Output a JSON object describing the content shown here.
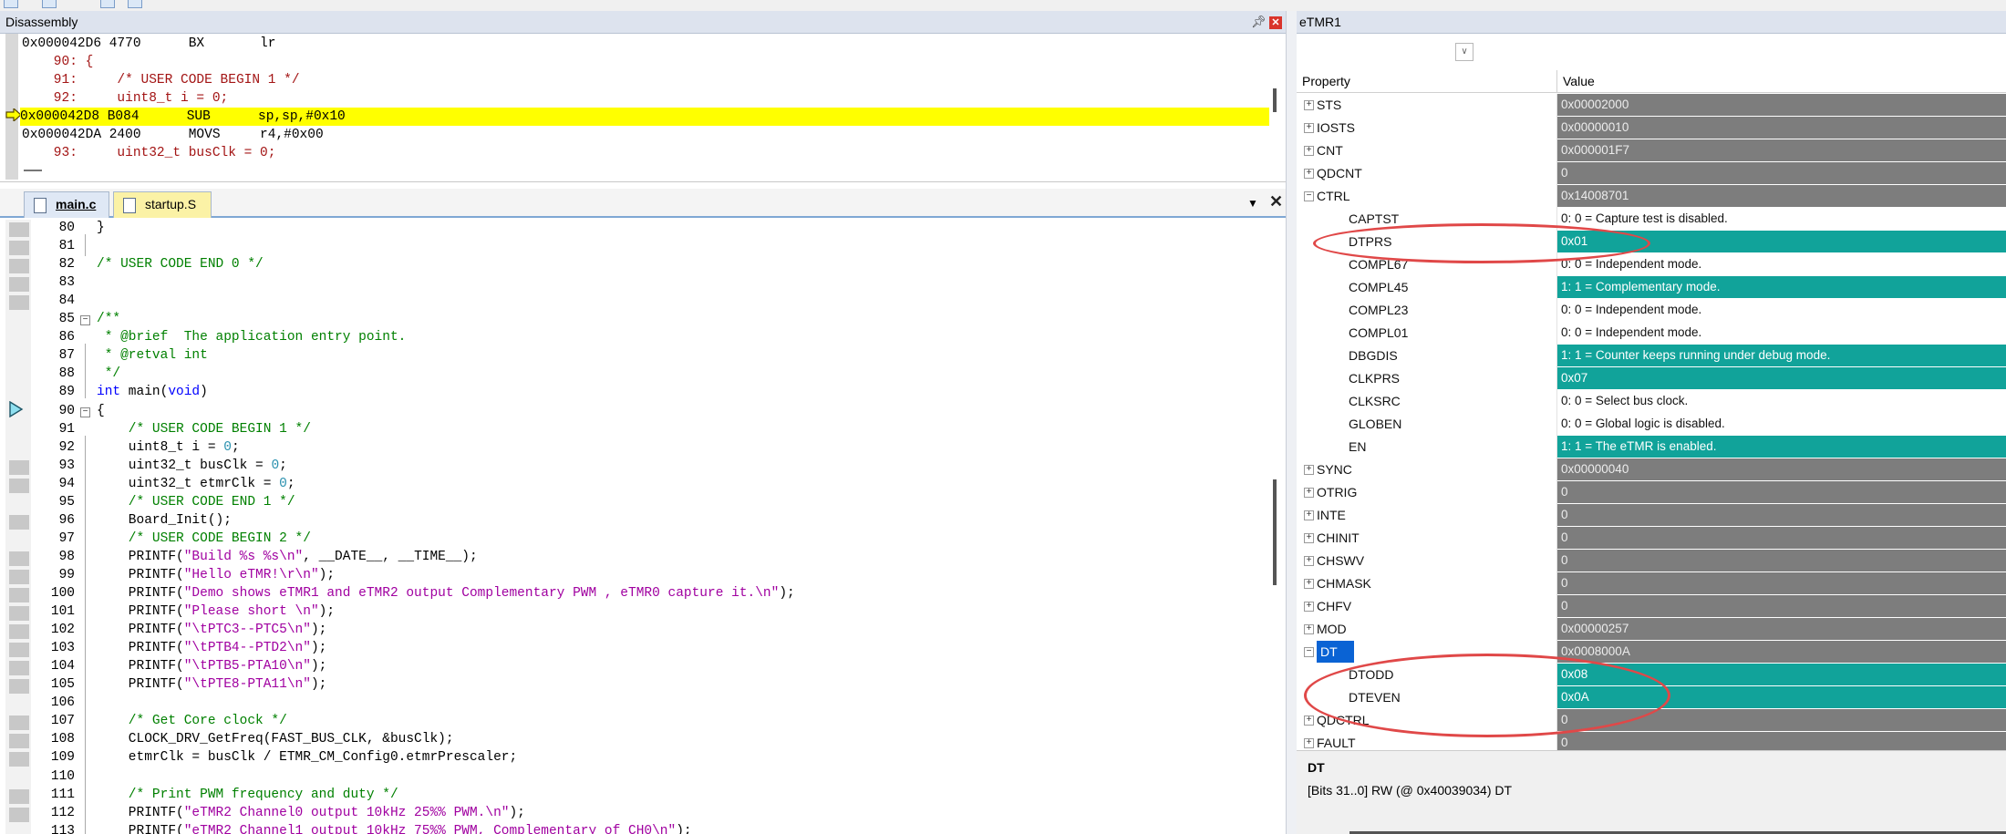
{
  "disassembly": {
    "title": "Disassembly",
    "pin_icon": "pin-icon",
    "close_icon": "close-icon",
    "lines": [
      {
        "text": "0x000042D6 4770      BX       lr",
        "kind": "asm"
      },
      {
        "text": "    90: {",
        "kind": "src"
      },
      {
        "text": "    91:     /* USER CODE BEGIN 1 */",
        "kind": "src"
      },
      {
        "text": "    92:     uint8_t i = 0;",
        "kind": "src"
      },
      {
        "text": "0x000042D8 B084      SUB      sp,sp,#0x10",
        "kind": "current"
      },
      {
        "text": "0x000042DA 2400      MOVS     r4,#0x00",
        "kind": "asm"
      },
      {
        "text": "    93:     uint32_t busClk = 0;",
        "kind": "src"
      }
    ]
  },
  "editor": {
    "tabs": [
      {
        "label": "main.c",
        "active": true
      },
      {
        "label": "startup.S",
        "active": false
      }
    ],
    "lines": [
      {
        "n": "80",
        "code": "}"
      },
      {
        "n": "81",
        "code": ""
      },
      {
        "n": "82",
        "code": "/* USER CODE END 0 */"
      },
      {
        "n": "83",
        "code": ""
      },
      {
        "n": "84",
        "code": ""
      },
      {
        "n": "85",
        "code": "/**"
      },
      {
        "n": "86",
        "code": " * @brief  The application entry point."
      },
      {
        "n": "87",
        "code": " * @retval int"
      },
      {
        "n": "88",
        "code": " */"
      },
      {
        "n": "89",
        "code": "int main(void)"
      },
      {
        "n": "90",
        "code": "{"
      },
      {
        "n": "91",
        "code": "    /* USER CODE BEGIN 1 */"
      },
      {
        "n": "92",
        "code": "    uint8_t i = 0;"
      },
      {
        "n": "93",
        "code": "    uint32_t busClk = 0;"
      },
      {
        "n": "94",
        "code": "    uint32_t etmrClk = 0;"
      },
      {
        "n": "95",
        "code": "    /* USER CODE END 1 */"
      },
      {
        "n": "96",
        "code": "    Board_Init();"
      },
      {
        "n": "97",
        "code": "    /* USER CODE BEGIN 2 */"
      },
      {
        "n": "98",
        "code": "    PRINTF(\"Build %s %s\\n\", __DATE__, __TIME__);"
      },
      {
        "n": "99",
        "code": "    PRINTF(\"Hello eTMR!\\r\\n\");"
      },
      {
        "n": "100",
        "code": "    PRINTF(\"Demo shows eTMR1 and eTMR2 output Complementary PWM , eTMR0 capture it.\\n\");"
      },
      {
        "n": "101",
        "code": "    PRINTF(\"Please short \\n\");"
      },
      {
        "n": "102",
        "code": "    PRINTF(\"\\tPTC3--PTC5\\n\");"
      },
      {
        "n": "103",
        "code": "    PRINTF(\"\\tPTB4--PTD2\\n\");"
      },
      {
        "n": "104",
        "code": "    PRINTF(\"\\tPTB5-PTA10\\n\");"
      },
      {
        "n": "105",
        "code": "    PRINTF(\"\\tPTE8-PTA11\\n\");"
      },
      {
        "n": "106",
        "code": ""
      },
      {
        "n": "107",
        "code": "    /* Get Core clock */"
      },
      {
        "n": "108",
        "code": "    CLOCK_DRV_GetFreq(FAST_BUS_CLK, &busClk);"
      },
      {
        "n": "109",
        "code": "    etmrClk = busClk / ETMR_CM_Config0.etmrPrescaler;"
      },
      {
        "n": "110",
        "code": ""
      },
      {
        "n": "111",
        "code": "    /* Print PWM frequency and duty */"
      },
      {
        "n": "112",
        "code": "    PRINTF(\"eTMR2 Channel0 output 10kHz 25%% PWM.\\n\");"
      },
      {
        "n": "113",
        "code": "    PRINTF(\"eTMR2 Channel1 output 10kHz 75%% PWM, Complementary of CH0\\n\");"
      }
    ]
  },
  "etmr": {
    "title": "eTMR1",
    "combo_icon": "chevron-down-icon",
    "header_property": "Property",
    "header_value": "Value",
    "registers": [
      {
        "name": "STS",
        "value": "0x00002000",
        "level": 0,
        "style": "gray",
        "expander": "+"
      },
      {
        "name": "IOSTS",
        "value": "0x00000010",
        "level": 0,
        "style": "gray",
        "expander": "+"
      },
      {
        "name": "CNT",
        "value": "0x000001F7",
        "level": 0,
        "style": "gray",
        "expander": "+"
      },
      {
        "name": "QDCNT",
        "value": "0",
        "level": 0,
        "style": "gray",
        "expander": "+"
      },
      {
        "name": "CTRL",
        "value": "0x14008701",
        "level": 0,
        "style": "gray",
        "expander": "-"
      },
      {
        "name": "CAPTST",
        "value": "0: 0 = Capture test is disabled.",
        "level": 1,
        "style": "white",
        "expander": ""
      },
      {
        "name": "DTPRS",
        "value": "0x01",
        "level": 1,
        "style": "teal",
        "expander": ""
      },
      {
        "name": "COMPL67",
        "value": "0: 0 = Independent mode.",
        "level": 1,
        "style": "white",
        "expander": ""
      },
      {
        "name": "COMPL45",
        "value": "1: 1 = Complementary mode.",
        "level": 1,
        "style": "teal",
        "expander": ""
      },
      {
        "name": "COMPL23",
        "value": "0: 0 = Independent mode.",
        "level": 1,
        "style": "white",
        "expander": ""
      },
      {
        "name": "COMPL01",
        "value": "0: 0 = Independent mode.",
        "level": 1,
        "style": "white",
        "expander": ""
      },
      {
        "name": "DBGDIS",
        "value": "1: 1 = Counter keeps running under debug mode.",
        "level": 1,
        "style": "teal",
        "expander": ""
      },
      {
        "name": "CLKPRS",
        "value": "0x07",
        "level": 1,
        "style": "teal",
        "expander": ""
      },
      {
        "name": "CLKSRC",
        "value": "0: 0 = Select bus clock.",
        "level": 1,
        "style": "white",
        "expander": ""
      },
      {
        "name": "GLOBEN",
        "value": "0: 0 = Global logic is disabled.",
        "level": 1,
        "style": "white",
        "expander": ""
      },
      {
        "name": "EN",
        "value": "1: 1 = The eTMR is enabled.",
        "level": 1,
        "style": "teal",
        "expander": ""
      },
      {
        "name": "SYNC",
        "value": "0x00000040",
        "level": 0,
        "style": "gray",
        "expander": "+"
      },
      {
        "name": "OTRIG",
        "value": "0",
        "level": 0,
        "style": "gray",
        "expander": "+"
      },
      {
        "name": "INTE",
        "value": "0",
        "level": 0,
        "style": "gray",
        "expander": "+"
      },
      {
        "name": "CHINIT",
        "value": "0",
        "level": 0,
        "style": "gray",
        "expander": "+"
      },
      {
        "name": "CHSWV",
        "value": "0",
        "level": 0,
        "style": "gray",
        "expander": "+"
      },
      {
        "name": "CHMASK",
        "value": "0",
        "level": 0,
        "style": "gray",
        "expander": "+"
      },
      {
        "name": "CHFV",
        "value": "0",
        "level": 0,
        "style": "gray",
        "expander": "+"
      },
      {
        "name": "MOD",
        "value": "0x00000257",
        "level": 0,
        "style": "gray",
        "expander": "+"
      },
      {
        "name": "DT",
        "value": "0x0008000A",
        "level": 0,
        "style": "gray",
        "expander": "-",
        "selected": true
      },
      {
        "name": "DTODD",
        "value": "0x08",
        "level": 1,
        "style": "teal",
        "expander": ""
      },
      {
        "name": "DTEVEN",
        "value": "0x0A",
        "level": 1,
        "style": "teal",
        "expander": ""
      },
      {
        "name": "QDCTRL",
        "value": "0",
        "level": 0,
        "style": "gray",
        "expander": "+"
      },
      {
        "name": "FAULT",
        "value": "0",
        "level": 0,
        "style": "gray",
        "expander": "+"
      }
    ],
    "description": {
      "title": "DT",
      "text": "[Bits 31..0] RW (@ 0x40039034) DT"
    }
  },
  "colors": {
    "highlight_line": "#ffff00",
    "changed_value": "#11a39a",
    "register_value": "#7d7d7d",
    "annotation": "#e04848",
    "selection": "#0a63d4"
  }
}
